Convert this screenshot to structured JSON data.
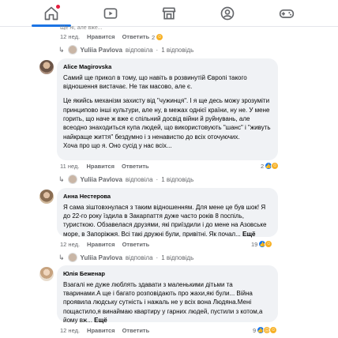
{
  "nav": {
    "items": [
      {
        "name": "home",
        "icon": "home-icon"
      },
      {
        "name": "video",
        "icon": "video-icon"
      },
      {
        "name": "marketplace",
        "icon": "store-icon"
      },
      {
        "name": "groups",
        "icon": "groups-icon"
      },
      {
        "name": "gaming",
        "icon": "gaming-icon"
      }
    ],
    "notification_dot_color": "#e41e3f"
  },
  "top_partial": {
    "text_fragment": "Ще ні, але вже..."
  },
  "comments": [
    {
      "meta": {
        "time": "12 нед.",
        "like": "Нравится",
        "reply": "Ответить",
        "count": "2"
      },
      "reply_summary": {
        "name": "Yuliia Pavlova",
        "verb": "відповіла",
        "sep": "·",
        "count": "1 відповідь"
      }
    },
    {
      "author": "Alice Magirovska",
      "paragraphs": [
        "Самий ще прикол в тому, що навіть в розвинутій Європі такого відношення вистачає. Не так масово, але є.",
        "Це якийсь механізм захисту від \"чужинця\". І я ще десь можу зрозуміти принципово інші культури, але ну, в межах однієї країни, ну не. У мене горить, що наче ж вже є спільний досвід війни й руйнувань, але всеодно знаходиться купа людей, що використовують \"шанс\" і \"живуть найкраще життя\" бездумно і з ненавистю до всіх оточуючих.\nХоча про що я. Оно сусід у нас всіх..."
      ],
      "meta": {
        "time": "11 нед.",
        "like": "Нравится",
        "reply": "Ответить",
        "count": "2"
      },
      "reply_summary": {
        "name": "Yuliia Pavlova",
        "verb": "відповіла",
        "sep": "·",
        "count": "1 відповідь"
      }
    },
    {
      "author": "Анна Нестерова",
      "text": "Я сама зіштовхнулася з таким відношенням. Для мене це був шок! Я до 22-го року їздила в Закарпаття дуже часто років 8 поспіль, туристкою. Обзавелася друзями, які приїздили і до мене на Азовське море, в Запоріжжя. Всі такі дружні були, привітні. Як почал...",
      "more": "Ещё",
      "meta": {
        "time": "12 нед.",
        "like": "Нравится",
        "reply": "Ответить",
        "count": "19"
      },
      "reply_summary": {
        "name": "Yuliia Pavlova",
        "verb": "відповіла",
        "sep": "·",
        "count": "1 відповідь"
      }
    },
    {
      "author": "Юлія Беженар",
      "text": "Взагалі не дуже люблять здавати з маленькими дітьми та тваринами.А ще і багато розповідають про жахи,які були... Війна проявила людську сутність і нажаль не у всіх вона Людяна.Мені пощастило,я винаймаю квартиру у гарних людей, пустили з котом,а йому вж...",
      "more": "Ещё",
      "meta": {
        "time": "12 нед.",
        "like": "Нравится",
        "reply": "Ответить",
        "count": "9"
      }
    }
  ],
  "colors": {
    "accent": "#1b74e4",
    "bubble": "#f0f2f5",
    "meta_text": "#65676b",
    "like": "#1877f2",
    "love": "#f33e58",
    "care": "#f7b125"
  }
}
